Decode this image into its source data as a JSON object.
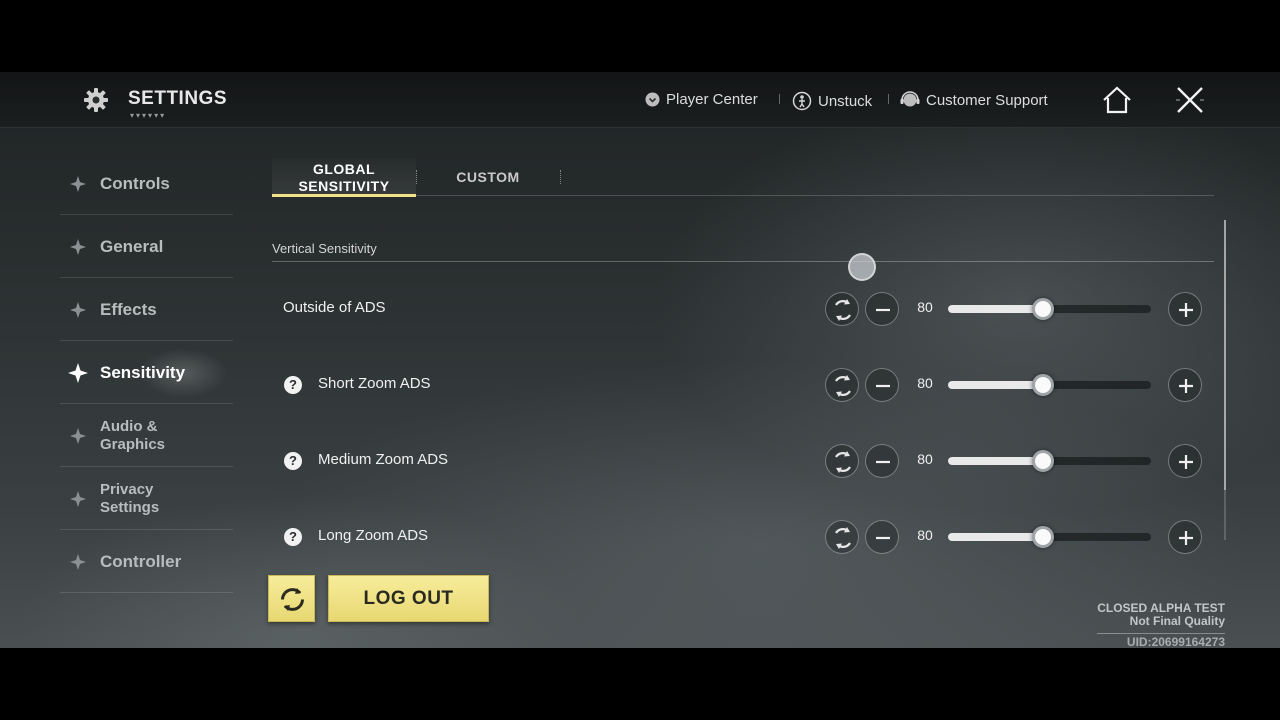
{
  "header": {
    "title": "SETTINGS",
    "title_deco": "▾▾▾▾▾▾",
    "links": [
      {
        "label": "Player Center",
        "icon": "shield-icon"
      },
      {
        "label": "Unstuck",
        "icon": "unstuck-icon"
      },
      {
        "label": "Customer Support",
        "icon": "support-icon"
      }
    ],
    "home_icon": "home-icon",
    "close_icon": "close-icon"
  },
  "sidebar": {
    "items": [
      {
        "label": "Controls"
      },
      {
        "label": "General"
      },
      {
        "label": "Effects"
      },
      {
        "label": "Sensitivity",
        "active": true
      },
      {
        "label_line1": "Audio &",
        "label_line2": "Graphics"
      },
      {
        "label_line1": "Privacy",
        "label_line2": "Settings"
      },
      {
        "label": "Controller"
      }
    ]
  },
  "tabs": [
    {
      "label_line1": "GLOBAL",
      "label_line2": "SENSITIVITY",
      "active": true
    },
    {
      "label": "CUSTOM",
      "active": false
    }
  ],
  "section": {
    "title": "Vertical Sensitivity"
  },
  "rows": [
    {
      "label": "Outside of ADS",
      "value": "80",
      "level": 0.47,
      "help": false
    },
    {
      "label": "Short Zoom ADS",
      "value": "80",
      "level": 0.47,
      "help": true
    },
    {
      "label": "Medium Zoom ADS",
      "value": "80",
      "level": 0.47,
      "help": true
    },
    {
      "label": "Long Zoom ADS",
      "value": "80",
      "level": 0.47,
      "help": true
    }
  ],
  "buttons": {
    "logout": "LOG OUT",
    "help_glyph": "?"
  },
  "footer": {
    "line1": "CLOSED ALPHA TEST",
    "line2": "Not Final Quality",
    "uid": "UID:20699164273"
  },
  "colors": {
    "accent_yellow": "#f0e08a",
    "button_yellow": "#e8d873"
  }
}
